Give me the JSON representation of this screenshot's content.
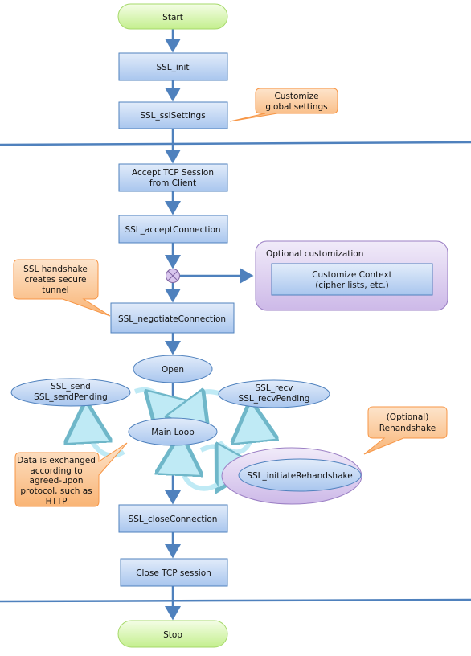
{
  "nodes": {
    "start": "Start",
    "ssl_init": "SSL_init",
    "ssl_settings": "SSL_sslSettings",
    "accept_tcp_1": "Accept TCP Session",
    "accept_tcp_2": "from Client",
    "accept_connection": "SSL_acceptConnection",
    "negotiate": "SSL_negotiateConnection",
    "open": "Open",
    "send_1": "SSL_send",
    "send_2": "SSL_sendPending",
    "recv_1": "SSL_recv",
    "recv_2": "SSL_recvPending",
    "main_loop": "Main Loop",
    "rehandshake": "SSL_initiateRehandshake",
    "close_connection": "SSL_closeConnection",
    "close_tcp": "Close TCP session",
    "stop": "Stop"
  },
  "group": {
    "title": "Optional customization",
    "inner_1": "Customize Context",
    "inner_2": "(cipher lists, etc.)"
  },
  "callouts": {
    "global_1": "Customize",
    "global_2": "global settings",
    "handshake_1": "SSL handshake",
    "handshake_2": "creates secure",
    "handshake_3": "tunnel",
    "rehandshake_1": "(Optional)",
    "rehandshake_2": "Rehandshake",
    "data_1": "Data is exchanged",
    "data_2": "according to",
    "data_3": "agreed-upon",
    "data_4": "protocol, such as",
    "data_5": "HTTP"
  },
  "colors": {
    "flow_line": "#4f81bd",
    "box_fill": "#c6d9f1",
    "terminal_fill": "#d7f5b0",
    "callout_fill": "#fbc48c",
    "group_fill": "#e4d9f2"
  }
}
